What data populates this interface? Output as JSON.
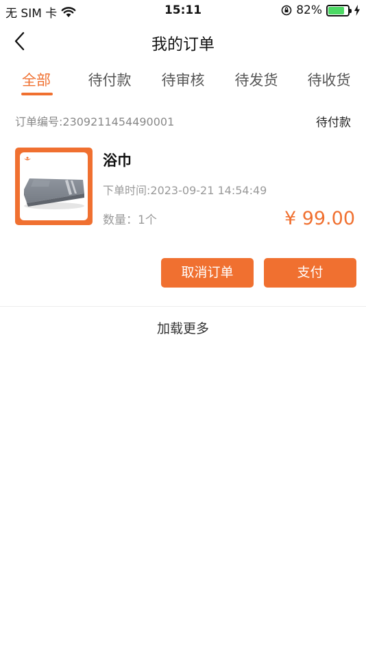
{
  "status_bar": {
    "carrier": "无 SIM 卡",
    "time": "15:11",
    "battery_percent": "82%",
    "battery_level": 0.82
  },
  "nav": {
    "title": "我的订单",
    "back_icon": "chevron-left-icon"
  },
  "tabs": [
    {
      "label": "全部",
      "active": true
    },
    {
      "label": "待付款",
      "active": false
    },
    {
      "label": "待审核",
      "active": false
    },
    {
      "label": "待发货",
      "active": false
    },
    {
      "label": "待收货",
      "active": false
    }
  ],
  "order": {
    "order_number": "订单编号:2309211454490001",
    "status": "待付款",
    "product_name": "浴巾",
    "order_time": "下单时间:2023-09-21 14:54:49",
    "quantity": "数量：1个",
    "price": "¥ 99.00",
    "buttons": {
      "cancel": "取消订单",
      "pay": "支付"
    }
  },
  "load_more": "加载更多",
  "colors": {
    "accent": "#f07030",
    "battery": "#4cd964"
  }
}
